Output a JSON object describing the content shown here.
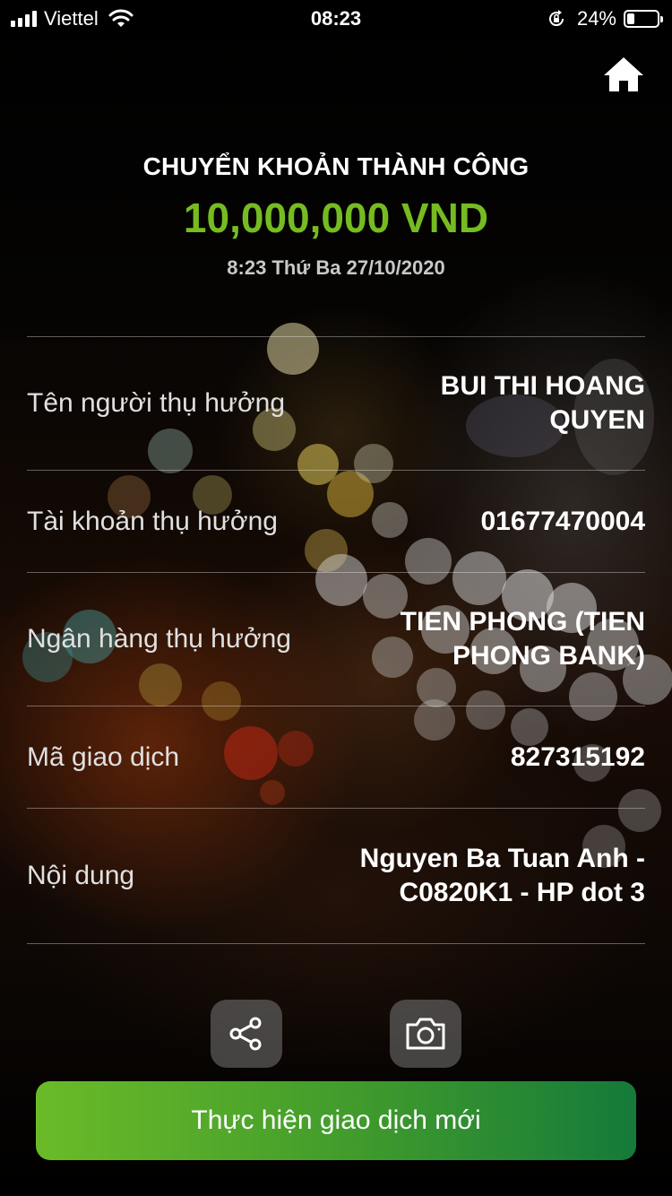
{
  "status_bar": {
    "carrier": "Viettel",
    "time": "08:23",
    "battery_percent": "24%",
    "battery_level": 0.24,
    "icons": [
      "signal-icon",
      "wifi-icon",
      "rotation-lock-icon",
      "battery-icon"
    ]
  },
  "header": {
    "title": "CHUYỂN KHOẢN THÀNH CÔNG",
    "amount": "10,000,000 VND",
    "datetime": "8:23 Thứ Ba 27/10/2020",
    "amount_color": "#76bc21"
  },
  "details": [
    {
      "label": "Tên người thụ hưởng",
      "value": "BUI THI HOANG QUYEN"
    },
    {
      "label": "Tài khoản thụ hưởng",
      "value": "01677470004"
    },
    {
      "label": "Ngân hàng thụ hưởng",
      "value": "TIEN PHONG (TIEN PHONG BANK)"
    },
    {
      "label": "Mã giao dịch",
      "value": "827315192"
    },
    {
      "label": "Nội dung",
      "value": "Nguyen Ba Tuan Anh - C0820K1 - HP dot 3"
    }
  ],
  "actions": {
    "icons": [
      "home-icon",
      "share-icon",
      "camera-icon"
    ],
    "new_transaction_label": "Thực hiện giao dịch mới",
    "button_colors": [
      "#6bbb28",
      "#157a3a"
    ]
  }
}
